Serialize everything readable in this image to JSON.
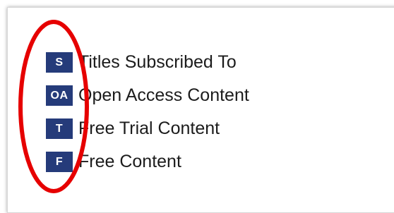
{
  "colors": {
    "badge_bg": "#253b7a",
    "highlight": "#e60000"
  },
  "legend": {
    "items": [
      {
        "badge": "S",
        "label": "Titles Subscribed To"
      },
      {
        "badge": "OA",
        "label": "Open Access Content"
      },
      {
        "badge": "T",
        "label": "Free Trial Content"
      },
      {
        "badge": "F",
        "label": "Free Content"
      }
    ]
  },
  "annotation": {
    "shape": "ellipse"
  }
}
